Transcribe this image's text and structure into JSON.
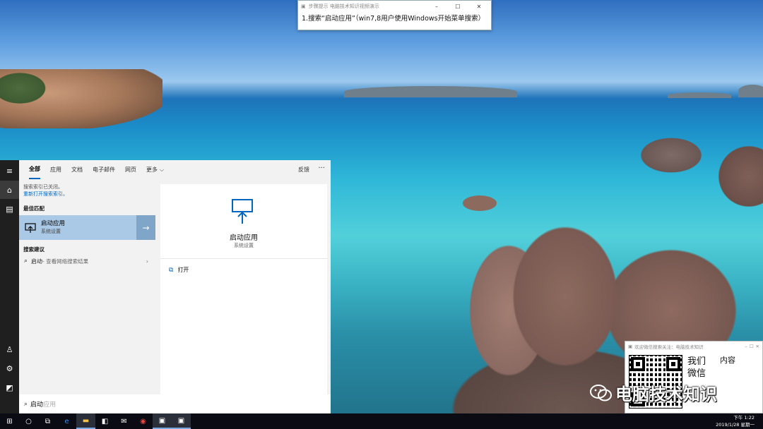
{
  "step_window": {
    "title": "步骤提示 电脑技术知识视频演示",
    "instruction": "1.搜索“启动应用”（win7,8用户使用Windows开始菜单搜索）",
    "minimize": "–",
    "maximize": "☐",
    "close": "✕"
  },
  "search_panel": {
    "tabs": [
      "全部",
      "应用",
      "文档",
      "电子邮件",
      "网页",
      "更多"
    ],
    "feedback": "反馈",
    "more_options": "···",
    "index_notice": "搜索索引已关闭。",
    "index_link": "重新打开搜索索引。",
    "best_match_header": "最佳匹配",
    "best_match": {
      "name": "启动应用",
      "category": "系统设置"
    },
    "suggestions_header": "搜索建议",
    "suggestion": {
      "term": "启动",
      "detail": " - 查看网络搜索结果"
    },
    "detail": {
      "name": "启动应用",
      "category": "系统设置",
      "open_action": "打开"
    },
    "search_text": "启动",
    "search_ghost": "应用"
  },
  "promo_window": {
    "title": "欢迎微信搜索关注：电脑技术知识",
    "handwriting": [
      "我们",
      "微信"
    ],
    "handwriting2": "内容",
    "brand": "电脑技术知识"
  },
  "taskbar": {
    "time": "下午 1:22",
    "date": "2019/1/28 星期一"
  },
  "icons": {
    "start": "windows-icon",
    "cortana": "circle-icon",
    "taskview": "taskview-icon",
    "edge": "edge-icon",
    "explorer": "folder-icon",
    "store": "store-icon",
    "mail": "mail-icon",
    "chrome": "chrome-icon"
  },
  "colors": {
    "accent": "#0067c0",
    "best_match_bg": "#aac9e6",
    "taskbar": "#0b0b14"
  }
}
